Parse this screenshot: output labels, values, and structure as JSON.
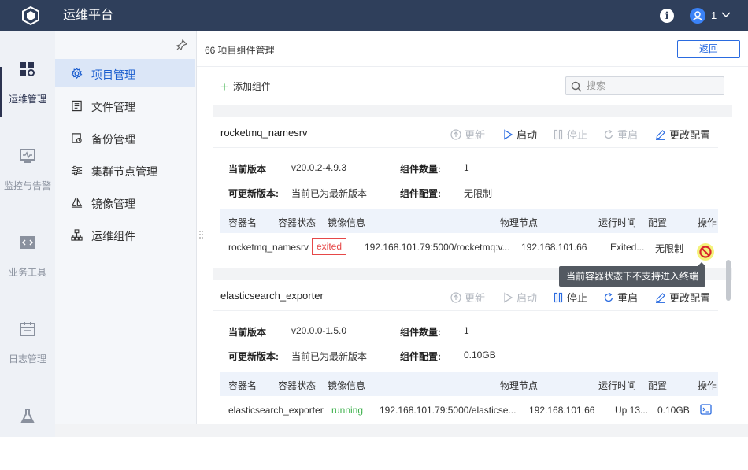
{
  "header": {
    "app_title": "运维平台",
    "user_name": "1"
  },
  "rail": {
    "items": [
      "运维管理",
      "监控与告警",
      "业务工具",
      "日志管理"
    ]
  },
  "sidebar": {
    "items": [
      "项目管理",
      "文件管理",
      "备份管理",
      "集群节点管理",
      "镜像管理",
      "运维组件"
    ]
  },
  "page": {
    "breadcrumb": "66 项目组件管理",
    "back_label": "返回",
    "add_label": "添加组件",
    "search_placeholder": "搜索"
  },
  "actions": {
    "update": "更新",
    "start": "启动",
    "stop": "停止",
    "restart": "重启",
    "edit": "更改配置"
  },
  "labels": {
    "current_version": "当前版本",
    "updatable_version": "可更新版本:",
    "component_count": "组件数量:",
    "component_config": "组件配置:"
  },
  "table_headers": [
    "容器名",
    "容器状态",
    "镜像信息",
    "物理节点",
    "运行时间",
    "配置",
    "操作"
  ],
  "components": [
    {
      "name": "rocketmq_namesrv",
      "version": "v20.0.2-4.9.3",
      "updatable": "当前已为最新版本",
      "count": "1",
      "config": "无限制",
      "row": {
        "container": "rocketmq_namesrv",
        "status": "exited",
        "image": "192.168.101.79:5000/rocketmq:v...",
        "node": "192.168.101.66",
        "uptime": "Exited...",
        "config": "无限制"
      }
    },
    {
      "name": "elasticsearch_exporter",
      "version": "v20.0.0-1.5.0",
      "updatable": "当前已为最新版本",
      "count": "1",
      "config": "0.10GB",
      "row": {
        "container": "elasticsearch_exporter",
        "status": "running",
        "image": "192.168.101.79:5000/elasticse...",
        "node": "192.168.101.66",
        "uptime": "Up 13...",
        "config": "0.10GB"
      }
    }
  ],
  "tooltip": "当前容器状态下不支持进入终端",
  "colors": {
    "topbar": "#2f3f5b",
    "accent": "#1a5dcf",
    "danger": "#e64848",
    "success": "#3bb04a"
  }
}
